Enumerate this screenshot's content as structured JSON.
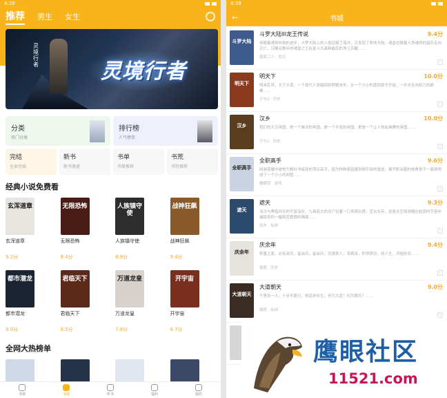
{
  "colors": {
    "accent": "#f9b41b",
    "score": "#f9a825",
    "watermark_blue": "#1f5fa8",
    "watermark_red": "#c2185b"
  },
  "left": {
    "status": {
      "time": "4:39"
    },
    "tabs": [
      {
        "label": "推荐",
        "active": true
      },
      {
        "label": "男生"
      },
      {
        "label": "女生"
      }
    ],
    "banner": {
      "title": "灵境行者",
      "vertical_text": "灵境行者"
    },
    "categories": {
      "big": [
        {
          "label": "分类",
          "sub": "热门分类"
        },
        {
          "label": "排行榜",
          "sub": "人气榜单"
        }
      ],
      "small": [
        {
          "label": "完结",
          "sub": "全本完结"
        },
        {
          "label": "新书",
          "sub": "新书速递"
        },
        {
          "label": "书单",
          "sub": "书单推荐"
        },
        {
          "label": "书荒",
          "sub": "书荒推荐"
        }
      ]
    },
    "section1": {
      "title": "经典小说免费看"
    },
    "books1": [
      {
        "name": "玄浑道章",
        "score": "9.2分",
        "cover_text": "玄浑道章",
        "cover_color": "#e8e4df"
      },
      {
        "name": "无限恐怖",
        "score": "9.4分",
        "cover_text": "无限恐怖",
        "cover_color": "#4a1c16"
      },
      {
        "name": "人族镇守使",
        "score": "8.9分",
        "cover_text": "人族镇守使",
        "cover_color": "#2d2d2d"
      },
      {
        "name": "战神狂飙",
        "score": "9.4分",
        "cover_text": "战神狂飙",
        "cover_color": "#8a5a2a"
      },
      {
        "name": "都市潜龙",
        "score": "9.0分",
        "cover_text": "都市潜龙",
        "cover_color": "#1b2433"
      },
      {
        "name": "君临天下",
        "score": "8.5分",
        "cover_text": "君临天下",
        "cover_color": "#5c2a1a"
      },
      {
        "name": "万道龙皇",
        "score": "7.8分",
        "cover_text": "万道龙皇",
        "cover_color": "#d8d2cc"
      },
      {
        "name": "开宇宙",
        "score": "8.7分",
        "cover_text": "开宇宙",
        "cover_color": "#7a2e1e"
      }
    ],
    "section2": {
      "title": "全网大热榜单"
    },
    "books2": [
      {
        "cover_color": "#cfd8e6"
      },
      {
        "cover_color": "#25344a"
      },
      {
        "cover_color": "#dfe6f0"
      },
      {
        "cover_color": "#3a4a66"
      }
    ],
    "nav": [
      {
        "label": "书架",
        "icon": "shelf-icon"
      },
      {
        "label": "书城",
        "icon": "store-icon",
        "active": true
      },
      {
        "label": "听书",
        "icon": "headphone-icon"
      },
      {
        "label": "福利",
        "icon": "gift-icon"
      },
      {
        "label": "我的",
        "icon": "user-icon"
      }
    ]
  },
  "right": {
    "status": {
      "time": "4:39"
    },
    "header": {
      "back": "←",
      "title": "书城"
    },
    "books": [
      {
        "name": "斗罗大陆III龙王传说",
        "score": "9.4分",
        "cover_text": "斗罗大陆",
        "cover_color": "#3c5a8c",
        "desc": "伴随着魂导科技的进步，斗罗大陆上的人类征服了海洋，又发现了两块大陆。魂兽也随着人类魂师的猎杀走向灭亡，沉睡无数年的魂兽之王在星斗大森林最后的净土苏醒……",
        "meta": "唐家三少 · 玄幻"
      },
      {
        "name": "明天下",
        "score": "10.0分",
        "cover_text": "明天下",
        "cover_color": "#8c3a1e",
        "desc": "明末乱世，天下大变。一个现代人穿越回到明朝末年，从一个小小的蓝田县令开始，一步步走向权力的巅峰……",
        "meta": "孑与2 · 历史"
      },
      {
        "name": "汉乡",
        "score": "10.0分",
        "cover_text": "汉乡",
        "cover_color": "#5a3c1e",
        "desc": "我们的大汉帝国，是一个雄浑的帝国，是一个不屈的帝国，更是一个让人热血沸腾的帝国……",
        "meta": "孑与2 · 历史"
      },
      {
        "name": "全职高手",
        "score": "9.6分",
        "cover_text": "全职高手",
        "cover_color": "#cbd4e3",
        "desc": "网游荣耀中被誉为教科书级别的顶尖高手，因为种种原因遭到俱乐部的驱逐，离开职业圈的他寄身于一家网吧成了一个小小的网管……",
        "meta": "蝴蝶蓝 · 游戏"
      },
      {
        "name": "遮天",
        "score": "9.3分",
        "cover_text": "遮天",
        "cover_color": "#2c4a6c",
        "desc": "冰冷与黑暗并存的宇宙深处，九具庞大的龙尸拉着一口青铜古棺，亘古长存。这是太空探测器在枯寂的宇宙中捕捉到的一幅极其震撼的画面……",
        "meta": "辰东 · 仙侠"
      },
      {
        "name": "庆余年",
        "score": "9.4分",
        "cover_text": "庆余年",
        "cover_color": "#e6e2dc",
        "desc": "积善之家，必有余庆，留余庆，留余庆，忽遇恩人；幸娘亲，积得阴功。劝人生，济困扶穷……",
        "meta": "猫腻 · 历史"
      },
      {
        "name": "大道朝天",
        "score": "9.0分",
        "cover_text": "大道朝天",
        "cover_color": "#3a2c22",
        "desc": "千里杀一人，十步不愿行。修道求长生，何为大道？何为朝天？……",
        "meta": "猫腻 · 仙侠"
      },
      {
        "name": "",
        "score": "",
        "cover_text": "",
        "cover_color": "#d6d6d6",
        "desc": "",
        "meta": ""
      }
    ]
  },
  "watermark": {
    "text": "鹰眼社区",
    "url": "11521.com"
  }
}
